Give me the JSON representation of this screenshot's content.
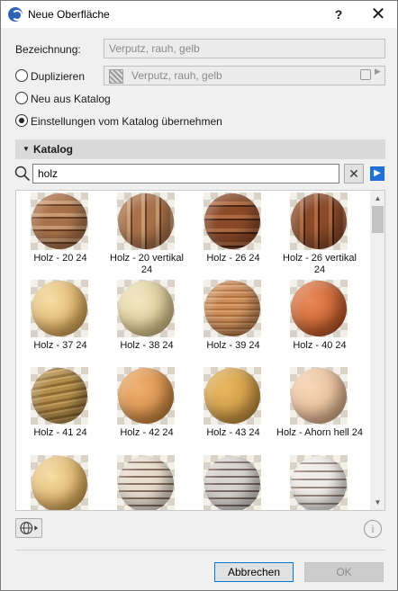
{
  "window": {
    "title": "Neue Oberfläche",
    "help_label": "?",
    "close_label": "✕"
  },
  "form": {
    "name_label": "Bezeichnung:",
    "name_placeholder": "Verputz, rauh, gelb",
    "duplicate_label": "Duplizieren",
    "duplicate_value": "Verputz, rauh, gelb",
    "new_from_catalog_label": "Neu aus Katalog",
    "apply_catalog_label": "Einstellungen vom Katalog übernehmen",
    "selected_option": "apply_catalog"
  },
  "catalog": {
    "header": "Katalog",
    "search_value": "holz",
    "clear_label": "✕",
    "items": [
      {
        "label": "Holz - 20 24",
        "style": "plank-h"
      },
      {
        "label": "Holz - 20 vertikal 24",
        "style": "plank-v"
      },
      {
        "label": "Holz - 26 24",
        "style": "dark-h"
      },
      {
        "label": "Holz - 26 vertikal 24",
        "style": "dark-v"
      },
      {
        "label": "Holz - 37 24",
        "style": "light-yellow"
      },
      {
        "label": "Holz - 38 24",
        "style": "cream"
      },
      {
        "label": "Holz - 39 24",
        "style": "brown-grain"
      },
      {
        "label": "Holz - 40 24",
        "style": "red-brown"
      },
      {
        "label": "Holz - 41 24",
        "style": "olive-brown"
      },
      {
        "label": "Holz - 42 24",
        "style": "orange-tan"
      },
      {
        "label": "Holz - 43 24",
        "style": "golden"
      },
      {
        "label": "Holz - Ahorn hell 24",
        "style": "pale-peach"
      },
      {
        "label": "",
        "style": "light-yellow"
      },
      {
        "label": "",
        "style": "striped-light"
      },
      {
        "label": "",
        "style": "striped-gray"
      },
      {
        "label": "",
        "style": "striped-white"
      }
    ]
  },
  "footer": {
    "cancel_label": "Abbrechen",
    "ok_label": "OK",
    "info_label": "i"
  },
  "colors": {
    "accent": "#0078d7",
    "title_icon": "#2f62b4"
  }
}
